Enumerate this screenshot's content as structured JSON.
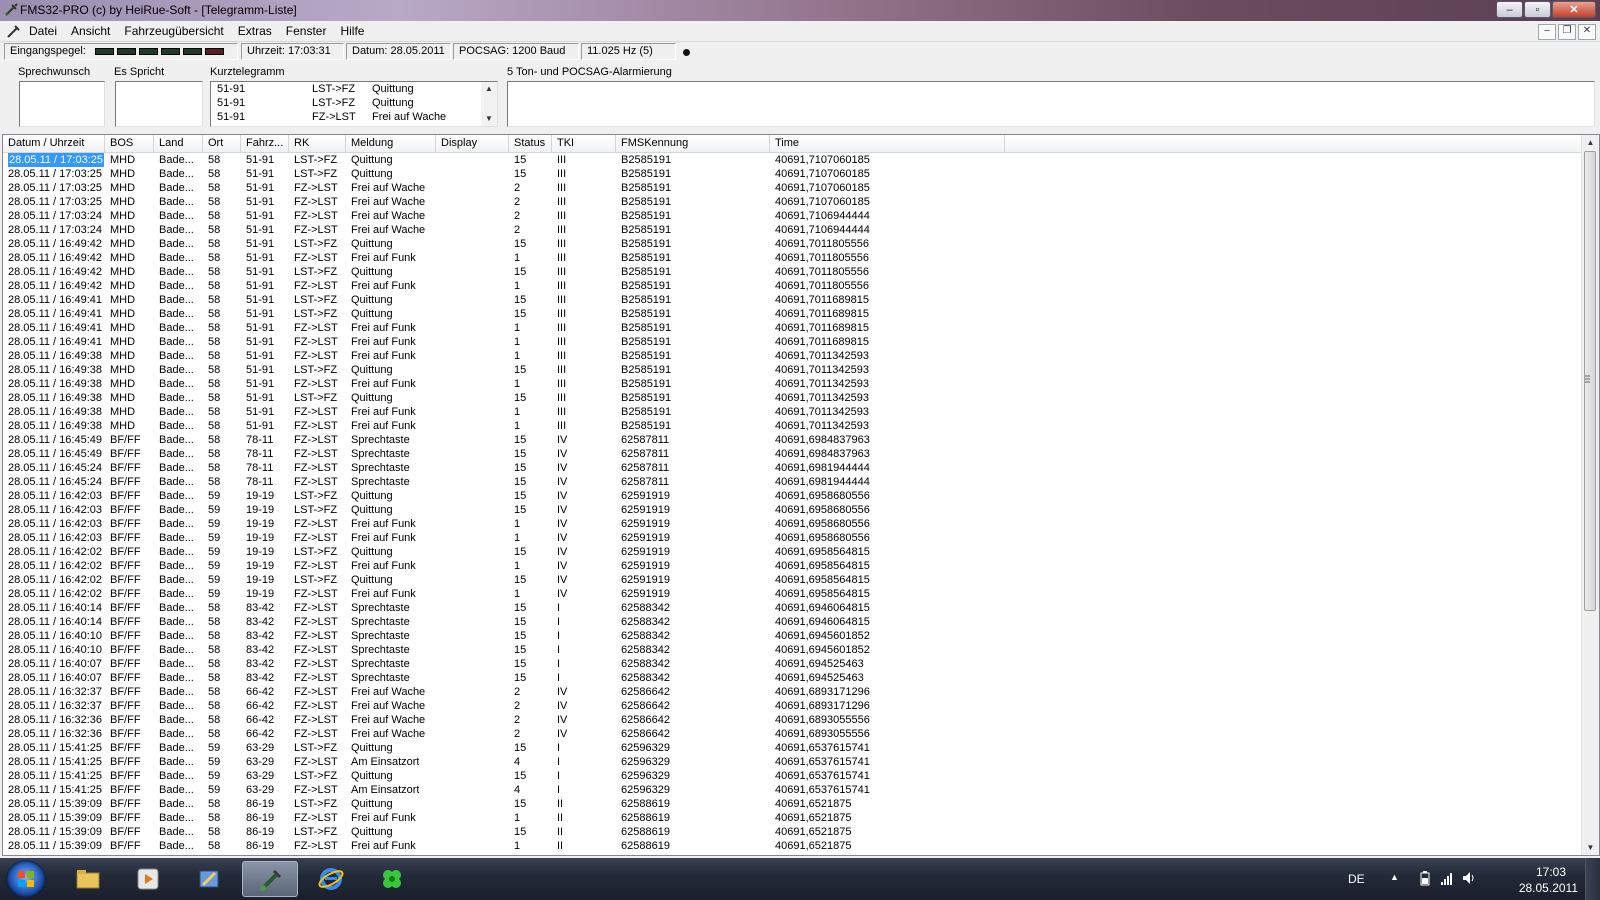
{
  "window": {
    "title": "FMS32-PRO (c) by HeiRue-Soft - [Telegramm-Liste]",
    "controls": {
      "minimize": "–",
      "maximize": "▫",
      "close": "✕"
    }
  },
  "menu": {
    "items": [
      "Datei",
      "Ansicht",
      "Fahrzeugübersicht",
      "Extras",
      "Fenster",
      "Hilfe"
    ],
    "mdi_controls": {
      "minimize": "–",
      "restore": "❐",
      "close": "✕"
    }
  },
  "status": {
    "eingangspegel_label": "Eingangspegel:",
    "uhrzeit": "Uhrzeit:  17:03:31",
    "datum": "Datum:  28.05.2011",
    "pocsag": "POCSAG: 1200 Baud",
    "hz": "11.025 Hz (5)"
  },
  "panels": {
    "sprechwunsch_label": "Sprechwunsch",
    "es_spricht_label": "Es Spricht",
    "kurztelegramm_label": "Kurztelegramm",
    "alarmierung_label": "5 Ton- und POCSAG-Alarmierung",
    "kurztelegramm_rows": [
      {
        "fahrzeug": "51-91",
        "rk": "LST->FZ",
        "meldung": "Quittung"
      },
      {
        "fahrzeug": "51-91",
        "rk": "LST->FZ",
        "meldung": "Quittung"
      },
      {
        "fahrzeug": "51-91",
        "rk": "FZ->LST",
        "meldung": "Frei auf Wache"
      }
    ]
  },
  "table": {
    "columns": [
      "Datum / Uhrzeit",
      "BOS",
      "Land",
      "Ort",
      "Fahrz...",
      "RK",
      "Meldung",
      "Display",
      "Status",
      "TKI",
      "FMSKennung",
      "Time"
    ],
    "rows": [
      [
        "28.05.11 / 17:03:25",
        "MHD",
        "Bade...",
        "58",
        "51-91",
        "LST->FZ",
        "Quittung",
        "",
        "15",
        "III",
        "B2585191",
        "40691,7107060185"
      ],
      [
        "28.05.11 / 17:03:25",
        "MHD",
        "Bade...",
        "58",
        "51-91",
        "LST->FZ",
        "Quittung",
        "",
        "15",
        "III",
        "B2585191",
        "40691,7107060185"
      ],
      [
        "28.05.11 / 17:03:25",
        "MHD",
        "Bade...",
        "58",
        "51-91",
        "FZ->LST",
        "Frei auf Wache",
        "",
        "2",
        "III",
        "B2585191",
        "40691,7107060185"
      ],
      [
        "28.05.11 / 17:03:25",
        "MHD",
        "Bade...",
        "58",
        "51-91",
        "FZ->LST",
        "Frei auf Wache",
        "",
        "2",
        "III",
        "B2585191",
        "40691,7107060185"
      ],
      [
        "28.05.11 / 17:03:24",
        "MHD",
        "Bade...",
        "58",
        "51-91",
        "FZ->LST",
        "Frei auf Wache",
        "",
        "2",
        "III",
        "B2585191",
        "40691,7106944444"
      ],
      [
        "28.05.11 / 17:03:24",
        "MHD",
        "Bade...",
        "58",
        "51-91",
        "FZ->LST",
        "Frei auf Wache",
        "",
        "2",
        "III",
        "B2585191",
        "40691,7106944444"
      ],
      [
        "28.05.11 / 16:49:42",
        "MHD",
        "Bade...",
        "58",
        "51-91",
        "LST->FZ",
        "Quittung",
        "",
        "15",
        "III",
        "B2585191",
        "40691,7011805556"
      ],
      [
        "28.05.11 / 16:49:42",
        "MHD",
        "Bade...",
        "58",
        "51-91",
        "FZ->LST",
        "Frei auf Funk",
        "",
        "1",
        "III",
        "B2585191",
        "40691,7011805556"
      ],
      [
        "28.05.11 / 16:49:42",
        "MHD",
        "Bade...",
        "58",
        "51-91",
        "LST->FZ",
        "Quittung",
        "",
        "15",
        "III",
        "B2585191",
        "40691,7011805556"
      ],
      [
        "28.05.11 / 16:49:42",
        "MHD",
        "Bade...",
        "58",
        "51-91",
        "FZ->LST",
        "Frei auf Funk",
        "",
        "1",
        "III",
        "B2585191",
        "40691,7011805556"
      ],
      [
        "28.05.11 / 16:49:41",
        "MHD",
        "Bade...",
        "58",
        "51-91",
        "LST->FZ",
        "Quittung",
        "",
        "15",
        "III",
        "B2585191",
        "40691,7011689815"
      ],
      [
        "28.05.11 / 16:49:41",
        "MHD",
        "Bade...",
        "58",
        "51-91",
        "LST->FZ",
        "Quittung",
        "",
        "15",
        "III",
        "B2585191",
        "40691,7011689815"
      ],
      [
        "28.05.11 / 16:49:41",
        "MHD",
        "Bade...",
        "58",
        "51-91",
        "FZ->LST",
        "Frei auf Funk",
        "",
        "1",
        "III",
        "B2585191",
        "40691,7011689815"
      ],
      [
        "28.05.11 / 16:49:41",
        "MHD",
        "Bade...",
        "58",
        "51-91",
        "FZ->LST",
        "Frei auf Funk",
        "",
        "1",
        "III",
        "B2585191",
        "40691,7011689815"
      ],
      [
        "28.05.11 / 16:49:38",
        "MHD",
        "Bade...",
        "58",
        "51-91",
        "FZ->LST",
        "Frei auf Funk",
        "",
        "1",
        "III",
        "B2585191",
        "40691,7011342593"
      ],
      [
        "28.05.11 / 16:49:38",
        "MHD",
        "Bade...",
        "58",
        "51-91",
        "LST->FZ",
        "Quittung",
        "",
        "15",
        "III",
        "B2585191",
        "40691,7011342593"
      ],
      [
        "28.05.11 / 16:49:38",
        "MHD",
        "Bade...",
        "58",
        "51-91",
        "FZ->LST",
        "Frei auf Funk",
        "",
        "1",
        "III",
        "B2585191",
        "40691,7011342593"
      ],
      [
        "28.05.11 / 16:49:38",
        "MHD",
        "Bade...",
        "58",
        "51-91",
        "LST->FZ",
        "Quittung",
        "",
        "15",
        "III",
        "B2585191",
        "40691,7011342593"
      ],
      [
        "28.05.11 / 16:49:38",
        "MHD",
        "Bade...",
        "58",
        "51-91",
        "FZ->LST",
        "Frei auf Funk",
        "",
        "1",
        "III",
        "B2585191",
        "40691,7011342593"
      ],
      [
        "28.05.11 / 16:49:38",
        "MHD",
        "Bade...",
        "58",
        "51-91",
        "FZ->LST",
        "Frei auf Funk",
        "",
        "1",
        "III",
        "B2585191",
        "40691,7011342593"
      ],
      [
        "28.05.11 / 16:45:49",
        "BF/FF",
        "Bade...",
        "58",
        "78-11",
        "FZ->LST",
        "Sprechtaste",
        "",
        "15",
        "IV",
        "62587811",
        "40691,6984837963"
      ],
      [
        "28.05.11 / 16:45:49",
        "BF/FF",
        "Bade...",
        "58",
        "78-11",
        "FZ->LST",
        "Sprechtaste",
        "",
        "15",
        "IV",
        "62587811",
        "40691,6984837963"
      ],
      [
        "28.05.11 / 16:45:24",
        "BF/FF",
        "Bade...",
        "58",
        "78-11",
        "FZ->LST",
        "Sprechtaste",
        "",
        "15",
        "IV",
        "62587811",
        "40691,6981944444"
      ],
      [
        "28.05.11 / 16:45:24",
        "BF/FF",
        "Bade...",
        "58",
        "78-11",
        "FZ->LST",
        "Sprechtaste",
        "",
        "15",
        "IV",
        "62587811",
        "40691,6981944444"
      ],
      [
        "28.05.11 / 16:42:03",
        "BF/FF",
        "Bade...",
        "59",
        "19-19",
        "LST->FZ",
        "Quittung",
        "",
        "15",
        "IV",
        "62591919",
        "40691,6958680556"
      ],
      [
        "28.05.11 / 16:42:03",
        "BF/FF",
        "Bade...",
        "59",
        "19-19",
        "LST->FZ",
        "Quittung",
        "",
        "15",
        "IV",
        "62591919",
        "40691,6958680556"
      ],
      [
        "28.05.11 / 16:42:03",
        "BF/FF",
        "Bade...",
        "59",
        "19-19",
        "FZ->LST",
        "Frei auf Funk",
        "",
        "1",
        "IV",
        "62591919",
        "40691,6958680556"
      ],
      [
        "28.05.11 / 16:42:03",
        "BF/FF",
        "Bade...",
        "59",
        "19-19",
        "FZ->LST",
        "Frei auf Funk",
        "",
        "1",
        "IV",
        "62591919",
        "40691,6958680556"
      ],
      [
        "28.05.11 / 16:42:02",
        "BF/FF",
        "Bade...",
        "59",
        "19-19",
        "LST->FZ",
        "Quittung",
        "",
        "15",
        "IV",
        "62591919",
        "40691,6958564815"
      ],
      [
        "28.05.11 / 16:42:02",
        "BF/FF",
        "Bade...",
        "59",
        "19-19",
        "FZ->LST",
        "Frei auf Funk",
        "",
        "1",
        "IV",
        "62591919",
        "40691,6958564815"
      ],
      [
        "28.05.11 / 16:42:02",
        "BF/FF",
        "Bade...",
        "59",
        "19-19",
        "LST->FZ",
        "Quittung",
        "",
        "15",
        "IV",
        "62591919",
        "40691,6958564815"
      ],
      [
        "28.05.11 / 16:42:02",
        "BF/FF",
        "Bade...",
        "59",
        "19-19",
        "FZ->LST",
        "Frei auf Funk",
        "",
        "1",
        "IV",
        "62591919",
        "40691,6958564815"
      ],
      [
        "28.05.11 / 16:40:14",
        "BF/FF",
        "Bade...",
        "58",
        "83-42",
        "FZ->LST",
        "Sprechtaste",
        "",
        "15",
        "I",
        "62588342",
        "40691,6946064815"
      ],
      [
        "28.05.11 / 16:40:14",
        "BF/FF",
        "Bade...",
        "58",
        "83-42",
        "FZ->LST",
        "Sprechtaste",
        "",
        "15",
        "I",
        "62588342",
        "40691,6946064815"
      ],
      [
        "28.05.11 / 16:40:10",
        "BF/FF",
        "Bade...",
        "58",
        "83-42",
        "FZ->LST",
        "Sprechtaste",
        "",
        "15",
        "I",
        "62588342",
        "40691,6945601852"
      ],
      [
        "28.05.11 / 16:40:10",
        "BF/FF",
        "Bade...",
        "58",
        "83-42",
        "FZ->LST",
        "Sprechtaste",
        "",
        "15",
        "I",
        "62588342",
        "40691,6945601852"
      ],
      [
        "28.05.11 / 16:40:07",
        "BF/FF",
        "Bade...",
        "58",
        "83-42",
        "FZ->LST",
        "Sprechtaste",
        "",
        "15",
        "I",
        "62588342",
        "40691,694525463"
      ],
      [
        "28.05.11 / 16:40:07",
        "BF/FF",
        "Bade...",
        "58",
        "83-42",
        "FZ->LST",
        "Sprechtaste",
        "",
        "15",
        "I",
        "62588342",
        "40691,694525463"
      ],
      [
        "28.05.11 / 16:32:37",
        "BF/FF",
        "Bade...",
        "58",
        "66-42",
        "FZ->LST",
        "Frei auf Wache",
        "",
        "2",
        "IV",
        "62586642",
        "40691,6893171296"
      ],
      [
        "28.05.11 / 16:32:37",
        "BF/FF",
        "Bade...",
        "58",
        "66-42",
        "FZ->LST",
        "Frei auf Wache",
        "",
        "2",
        "IV",
        "62586642",
        "40691,6893171296"
      ],
      [
        "28.05.11 / 16:32:36",
        "BF/FF",
        "Bade...",
        "58",
        "66-42",
        "FZ->LST",
        "Frei auf Wache",
        "",
        "2",
        "IV",
        "62586642",
        "40691,6893055556"
      ],
      [
        "28.05.11 / 16:32:36",
        "BF/FF",
        "Bade...",
        "58",
        "66-42",
        "FZ->LST",
        "Frei auf Wache",
        "",
        "2",
        "IV",
        "62586642",
        "40691,6893055556"
      ],
      [
        "28.05.11 / 15:41:25",
        "BF/FF",
        "Bade...",
        "59",
        "63-29",
        "LST->FZ",
        "Quittung",
        "",
        "15",
        "I",
        "62596329",
        "40691,6537615741"
      ],
      [
        "28.05.11 / 15:41:25",
        "BF/FF",
        "Bade...",
        "59",
        "63-29",
        "FZ->LST",
        "Am Einsatzort",
        "",
        "4",
        "I",
        "62596329",
        "40691,6537615741"
      ],
      [
        "28.05.11 / 15:41:25",
        "BF/FF",
        "Bade...",
        "59",
        "63-29",
        "LST->FZ",
        "Quittung",
        "",
        "15",
        "I",
        "62596329",
        "40691,6537615741"
      ],
      [
        "28.05.11 / 15:41:25",
        "BF/FF",
        "Bade...",
        "59",
        "63-29",
        "FZ->LST",
        "Am Einsatzort",
        "",
        "4",
        "I",
        "62596329",
        "40691,6537615741"
      ],
      [
        "28.05.11 / 15:39:09",
        "BF/FF",
        "Bade...",
        "58",
        "86-19",
        "LST->FZ",
        "Quittung",
        "",
        "15",
        "II",
        "62588619",
        "40691,6521875"
      ],
      [
        "28.05.11 / 15:39:09",
        "BF/FF",
        "Bade...",
        "58",
        "86-19",
        "FZ->LST",
        "Frei auf Funk",
        "",
        "1",
        "II",
        "62588619",
        "40691,6521875"
      ],
      [
        "28.05.11 / 15:39:09",
        "BF/FF",
        "Bade...",
        "58",
        "86-19",
        "LST->FZ",
        "Quittung",
        "",
        "15",
        "II",
        "62588619",
        "40691,6521875"
      ],
      [
        "28.05.11 / 15:39:09",
        "BF/FF",
        "Bade...",
        "58",
        "86-19",
        "FZ->LST",
        "Frei auf Funk",
        "",
        "1",
        "II",
        "62588619",
        "40691,6521875"
      ]
    ]
  },
  "taskbar": {
    "language": "DE",
    "time": "17:03",
    "date": "28.05.2011"
  },
  "colors": {
    "selection": "#3399ff",
    "list_background": "#ffffff",
    "taskbar": "#1e2431"
  }
}
